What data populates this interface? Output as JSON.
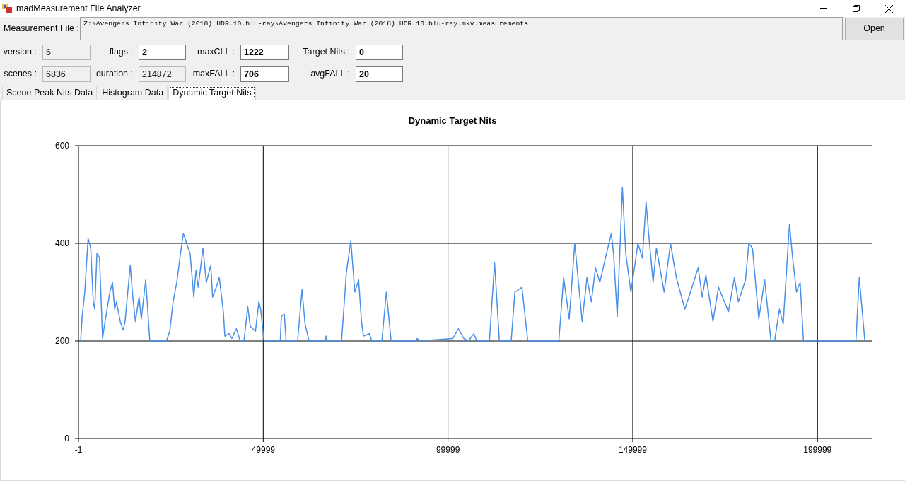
{
  "window": {
    "title": "madMeasurement File Analyzer"
  },
  "measurement_file": {
    "label": "Measurement File :",
    "value": "Z:\\Avengers Infinity War (2018) HDR.10.blu-ray\\Avengers Infinity War (2018) HDR.10.blu-ray.mkv.measurements"
  },
  "open_button": "Open",
  "fields": [
    {
      "label": "version :",
      "value": "6",
      "disabled": true
    },
    {
      "label": "flags :",
      "value": "2",
      "disabled": false
    },
    {
      "label": "maxCLL :",
      "value": "1222",
      "disabled": false
    },
    {
      "label": "Target Nits :",
      "value": "0",
      "disabled": false
    },
    {
      "label": "scenes :",
      "value": "6836",
      "disabled": true
    },
    {
      "label": "duration :",
      "value": "214872",
      "disabled": true
    },
    {
      "label": "maxFALL :",
      "value": "706",
      "disabled": false
    },
    {
      "label": "avgFALL :",
      "value": "20",
      "disabled": false
    }
  ],
  "tabs": [
    {
      "label": "Scene Peak Nits Data",
      "selected": false
    },
    {
      "label": "Histogram Data",
      "selected": false
    },
    {
      "label": "Dynamic Target Nits",
      "selected": true
    }
  ],
  "chart_data": {
    "type": "line",
    "grid": true,
    "title": "Dynamic Target Nits",
    "xlim": [
      -1,
      214872
    ],
    "ylim": [
      0,
      600
    ],
    "xticks": [
      -1,
      49999,
      99999,
      149999,
      199999
    ],
    "yticks": [
      0,
      200,
      400,
      600
    ],
    "x": [
      600,
      1000,
      1700,
      2600,
      3300,
      4000,
      4400,
      5000,
      5700,
      6500,
      7200,
      8500,
      9200,
      9800,
      10300,
      11300,
      12100,
      12600,
      14000,
      14700,
      15400,
      16400,
      17000,
      18200,
      19300,
      23800,
      24700,
      25600,
      26600,
      27800,
      28400,
      29700,
      30200,
      31200,
      31800,
      32400,
      33700,
      34600,
      35800,
      36300,
      37300,
      38100,
      39200,
      39600,
      40800,
      41500,
      42700,
      43800,
      44800,
      45800,
      46500,
      47900,
      48800,
      49300,
      50200,
      54600,
      54900,
      55700,
      56200,
      59300,
      60500,
      61300,
      62400,
      66800,
      67000,
      67400,
      71200,
      72500,
      73700,
      74800,
      75800,
      76600,
      77100,
      78700,
      79400,
      82100,
      83300,
      84600,
      90900,
      91700,
      92200,
      101300,
      102800,
      104300,
      105500,
      107000,
      107800,
      111200,
      112600,
      113900,
      117100,
      118100,
      120000,
      121600,
      130000,
      131300,
      132800,
      134300,
      136300,
      137600,
      138800,
      139900,
      141100,
      142600,
      144200,
      144800,
      145800,
      147200,
      148100,
      149500,
      151400,
      152600,
      153600,
      154300,
      155500,
      156400,
      158500,
      160200,
      161800,
      164100,
      165600,
      167700,
      168800,
      169800,
      171700,
      173200,
      175900,
      177500,
      178600,
      180500,
      181400,
      182400,
      184100,
      185700,
      187400,
      188400,
      189700,
      190700,
      192400,
      193200,
      194300,
      195300,
      196200,
      210400,
      211300,
      212800
    ],
    "series": [
      {
        "color": "#4a8fe7",
        "values": [
          200,
          250,
          300,
          410,
          390,
          280,
          265,
          380,
          370,
          205,
          240,
          300,
          320,
          265,
          280,
          240,
          222,
          240,
          355,
          290,
          240,
          290,
          245,
          325,
          200,
          200,
          220,
          280,
          320,
          390,
          420,
          390,
          380,
          290,
          345,
          310,
          390,
          320,
          355,
          290,
          310,
          330,
          260,
          210,
          215,
          205,
          225,
          200,
          200,
          270,
          230,
          220,
          280,
          265,
          200,
          200,
          250,
          255,
          200,
          200,
          305,
          235,
          200,
          200,
          210,
          200,
          200,
          340,
          405,
          300,
          325,
          240,
          210,
          215,
          200,
          200,
          300,
          200,
          200,
          205,
          200,
          205,
          225,
          205,
          200,
          215,
          200,
          200,
          360,
          200,
          200,
          300,
          310,
          200,
          200,
          330,
          245,
          400,
          240,
          330,
          280,
          350,
          320,
          370,
          420,
          380,
          250,
          515,
          380,
          300,
          400,
          370,
          485,
          420,
          320,
          390,
          300,
          400,
          330,
          265,
          300,
          350,
          290,
          335,
          240,
          310,
          260,
          330,
          280,
          325,
          400,
          390,
          245,
          325,
          200,
          200,
          265,
          235,
          440,
          375,
          300,
          320,
          200,
          200,
          330,
          200
        ]
      }
    ]
  }
}
